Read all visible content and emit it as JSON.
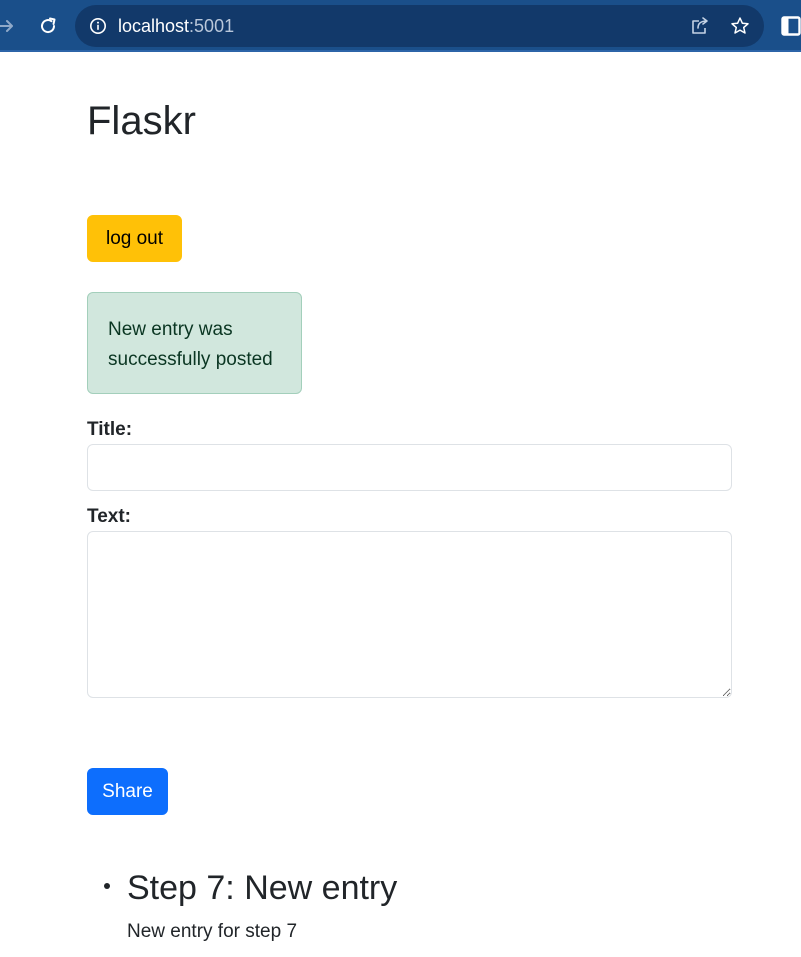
{
  "browser": {
    "url_host": "localhost",
    "url_port": ":5001",
    "icons": {
      "forward": "arrow-forward-icon",
      "reload": "reload-icon",
      "info": "info-icon",
      "share": "share-icon",
      "bookmark": "star-icon",
      "side_panel": "side-panel-icon"
    }
  },
  "page": {
    "title": "Flaskr",
    "logout_label": "log out",
    "flash_message": "New entry was successfully posted",
    "form": {
      "title_label": "Title:",
      "title_value": "",
      "text_label": "Text:",
      "text_value": "",
      "submit_label": "Share"
    },
    "entries": [
      {
        "title": "Step 7: New entry",
        "text": "New entry for step 7"
      }
    ]
  },
  "colors": {
    "browser_bar": "#1a4f8a",
    "omnibox": "#12396a",
    "logout_button": "#ffc107",
    "alert_background": "#d1e7dd",
    "alert_border": "#a3cfbb",
    "alert_text": "#0a3622",
    "share_button": "#0d6efd",
    "body_text": "#212529"
  }
}
